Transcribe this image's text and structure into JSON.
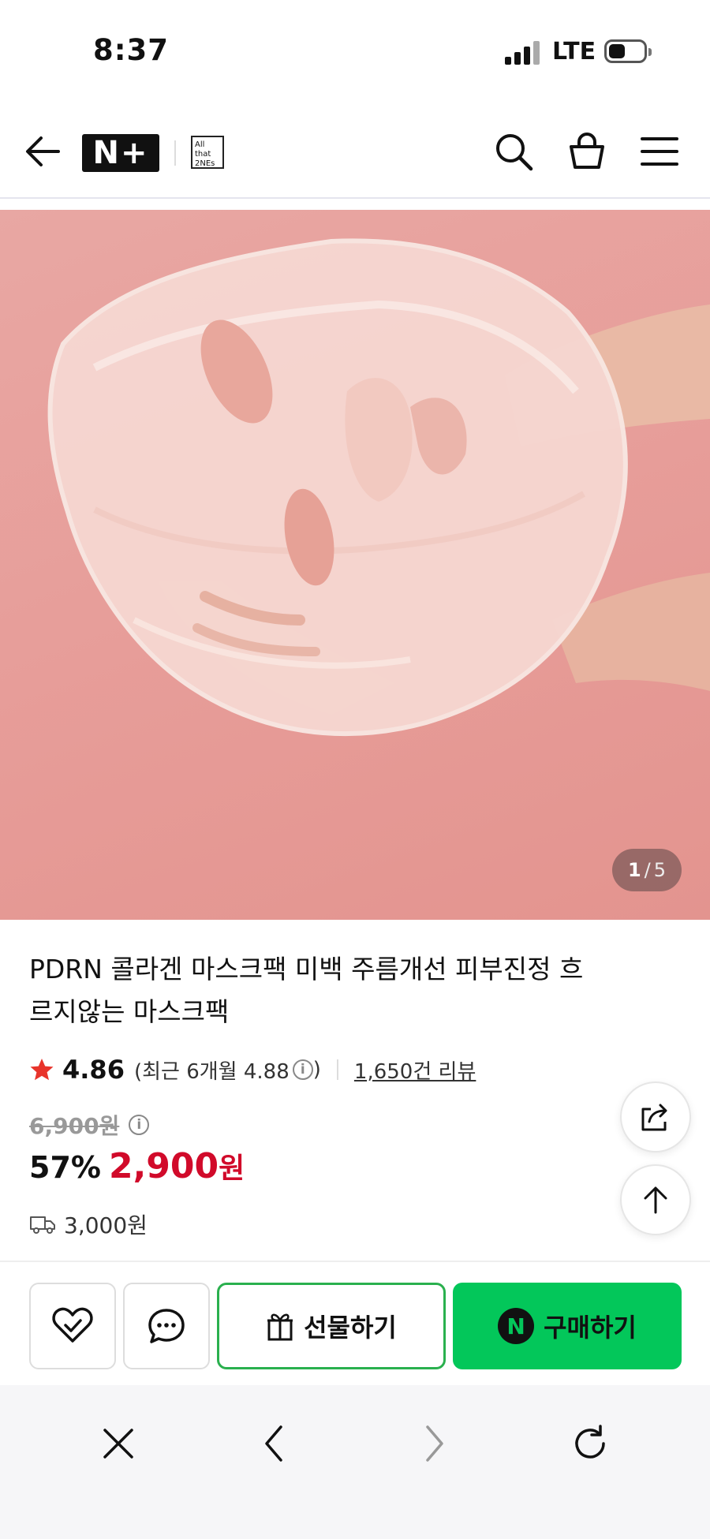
{
  "status_bar": {
    "time": "8:37",
    "network": "LTE"
  },
  "header": {
    "brand_badge": "N+",
    "store_logo_line1": "All that",
    "store_logo_line2": "2NEs"
  },
  "gallery": {
    "current": "1",
    "separator": "/",
    "total": "5"
  },
  "product": {
    "title": "PDRN 콜라겐 마스크팩 미백 주름개선 피부진정 흐르지않는 마스크팩",
    "rating": "4.86",
    "recent_rating": "(최근 6개월 4.88",
    "recent_rating_close": ")",
    "info_glyph": "i",
    "review_count": "1,650건 리뷰",
    "original_price": "6,900원",
    "discount": "57%",
    "price": "2,900",
    "price_unit": "원",
    "shipping_fee": "3,000원"
  },
  "actions": {
    "gift_label": "선물하기",
    "buy_badge": "N",
    "buy_label": "구매하기"
  },
  "colors": {
    "naver_green": "#03c75a",
    "price_red": "#d10a2a",
    "rating_star": "#e8342b"
  }
}
